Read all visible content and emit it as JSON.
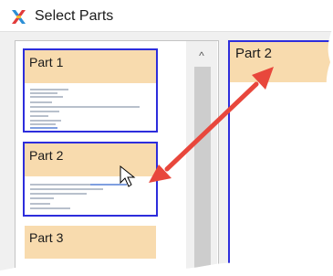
{
  "window": {
    "title": "Select Parts",
    "icon": "puzzle-x-icon"
  },
  "thumbnails": [
    {
      "label": "Part 1",
      "selected": false
    },
    {
      "label": "Part 2",
      "selected": true
    },
    {
      "label": "Part 3",
      "selected": false
    }
  ],
  "preview": {
    "label": "Part 2"
  },
  "scrollbar": {
    "up_arrow": "^"
  },
  "colors": {
    "part_header": "#f8dbae",
    "selection_border": "#2d2ddc",
    "arrow": "#e8473c"
  }
}
